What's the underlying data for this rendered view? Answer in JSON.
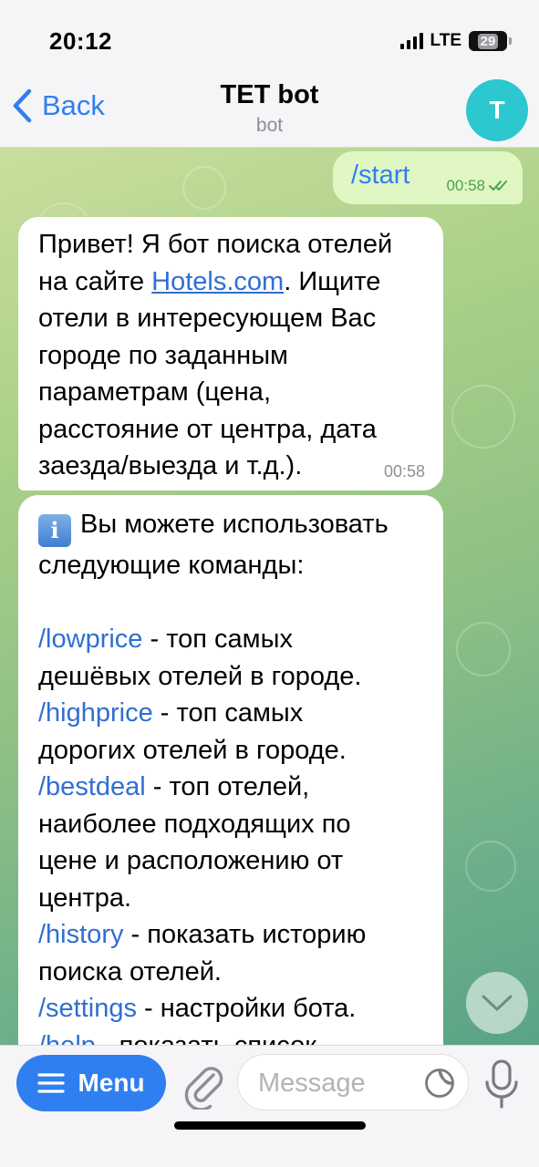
{
  "status": {
    "time": "20:12",
    "network": "LTE",
    "battery": "29"
  },
  "header": {
    "back_label": "Back",
    "title": "TET bot",
    "subtitle": "bot",
    "avatar_letter": "T"
  },
  "messages": {
    "outgoing": {
      "text": "/start",
      "time": "00:58"
    },
    "welcome": {
      "pre": "Привет! Я бот поиска отелей\nна сайте ",
      "link": "Hotels.com",
      "post": ". Ищите\nотели в интересующем Вас\nгороде по заданным\nпараметрам (цена,\nрасстояние от центра, дата\nзаезда/выезда и т.д.).",
      "time": "00:58"
    },
    "commands": {
      "intro_icon": "i",
      "intro": "Вы можете использовать\nследующие команды:",
      "items": [
        {
          "cmd": "/lowprice",
          "desc": " - топ самых\nдешёвых отелей в городе."
        },
        {
          "cmd": "/highprice",
          "desc": " - топ самых\nдорогих отелей в городе."
        },
        {
          "cmd": "/bestdeal",
          "desc": " - топ отелей,\nнаиболее подходящих по\nцене и расположению от\nцентра."
        },
        {
          "cmd": "/history",
          "desc": " - показать историю\nпоиска отелей."
        },
        {
          "cmd": "/settings",
          "desc": " - настройки бота."
        },
        {
          "cmd": "/help",
          "desc": " - показать список"
        }
      ]
    }
  },
  "input_bar": {
    "menu_label": "Menu",
    "placeholder": "Message"
  },
  "colors": {
    "accent": "#2f7ff0",
    "outgoing_bubble": "#e0f7c4",
    "avatar": "#2cc7cf"
  }
}
